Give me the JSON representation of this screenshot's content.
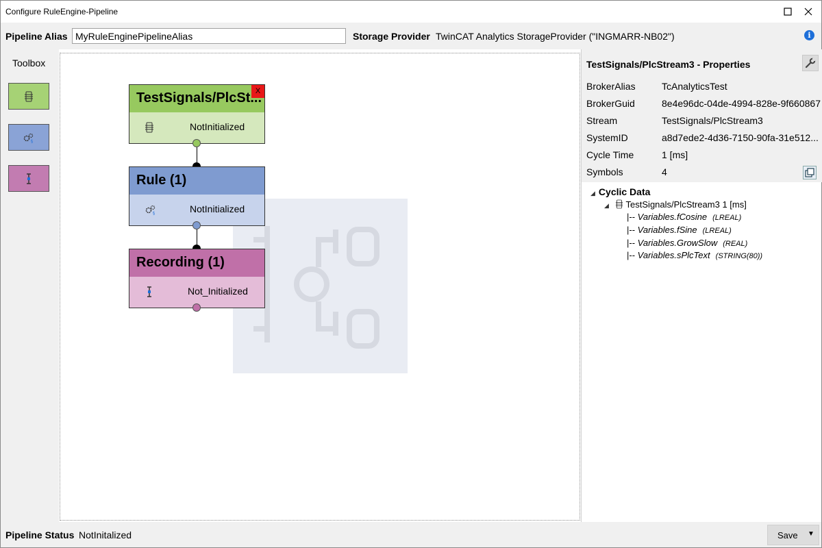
{
  "window": {
    "title": "Configure RuleEngine-Pipeline"
  },
  "header": {
    "alias_label": "Pipeline Alias",
    "alias_value": "MyRuleEnginePipelineAlias",
    "storage_label": "Storage Provider",
    "storage_value": "TwinCAT Analytics StorageProvider (\"INGMARR-NB02\")"
  },
  "toolbox": {
    "title": "Toolbox",
    "tools": [
      {
        "name": "stream-tool",
        "color": "#a6d275"
      },
      {
        "name": "rule-tool",
        "color": "#8aa3d6"
      },
      {
        "name": "recording-tool",
        "color": "#c27cb1"
      }
    ]
  },
  "nodes": [
    {
      "title": "TestSignals/PlcSt...",
      "status": "NotInitialized",
      "close": "X",
      "color": "#97c95f"
    },
    {
      "title": "Rule (1)",
      "status": "NotInitialized",
      "color": "#7f9bd0"
    },
    {
      "title": "Recording (1)",
      "status": "Not_Initialized",
      "color": "#c070a8"
    }
  ],
  "properties": {
    "title": "TestSignals/PlcStream3 - Properties",
    "rows": [
      {
        "key": "BrokerAlias",
        "value": "TcAnalyticsTest"
      },
      {
        "key": "BrokerGuid",
        "value": "8e4e96dc-04de-4994-828e-9f660867"
      },
      {
        "key": "Stream",
        "value": "TestSignals/PlcStream3"
      },
      {
        "key": "SystemID",
        "value": "a8d7ede2-4d36-7150-90fa-31e512..."
      },
      {
        "key": "Cycle Time",
        "value": "1 [ms]"
      },
      {
        "key": "Symbols",
        "value": "4"
      }
    ],
    "tree": {
      "root": "Cyclic Data",
      "stream": "TestSignals/PlcStream3 1 [ms]",
      "variables": [
        {
          "prefix": "|--",
          "name": "Variables.fCosine",
          "type": "(LREAL)"
        },
        {
          "prefix": "|--",
          "name": "Variables.fSine",
          "type": "(LREAL)"
        },
        {
          "prefix": "|--",
          "name": "Variables.GrowSlow",
          "type": "(REAL)"
        },
        {
          "prefix": "|--",
          "name": "Variables.sPlcText",
          "type": "(STRING(80))"
        }
      ]
    }
  },
  "statusbar": {
    "label": "Pipeline Status",
    "value": "NotInitalized",
    "save_label": "Save"
  }
}
